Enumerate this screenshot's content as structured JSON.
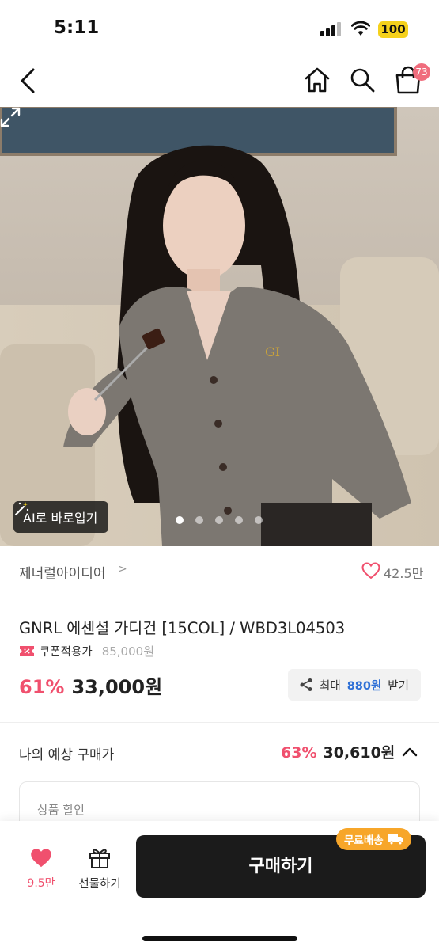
{
  "status_bar": {
    "time": "5:11",
    "battery": "100"
  },
  "nav": {
    "cart_count": "73"
  },
  "hero": {
    "ai_button_label": "AI로 바로입기",
    "slides": 5,
    "active_slide": 1
  },
  "brand": {
    "name": "제너럴아이디어",
    "likes": "42.5만"
  },
  "product": {
    "title": "GNRL 에센셜 가디건 [15COL] / WBD3L04503",
    "coupon_label": "쿠폰적용가",
    "original_price": "85,000원",
    "discount": "61%",
    "price": "33,000원",
    "reward_prefix": "최대",
    "reward_amount": "880원",
    "reward_suffix": "받기"
  },
  "expected": {
    "label": "나의 예상 구매가",
    "discount": "63%",
    "price": "30,610원"
  },
  "detail": {
    "label": "상품 할인"
  },
  "bottom_bar": {
    "wish_count": "9.5만",
    "gift_label": "선물하기",
    "buy_label": "구매하기",
    "shipping_badge": "무료배송"
  },
  "colors": {
    "accent_pink": "#f0506e",
    "reward_blue": "#2d6fd6",
    "shipping_orange": "#f7a62a",
    "buy_button": "#1b1b1b"
  }
}
